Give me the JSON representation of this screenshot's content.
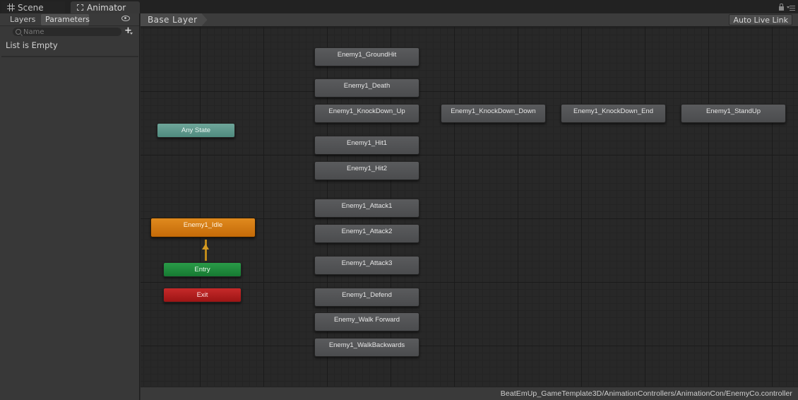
{
  "tabs": {
    "scene": {
      "label": "Scene",
      "icon": "grid-icon"
    },
    "animator": {
      "label": "Animator",
      "icon": "animator-icon"
    }
  },
  "left_panel": {
    "tabs": [
      "Layers",
      "Parameters"
    ],
    "active_tab": "Parameters",
    "search": {
      "placeholder": "Name",
      "value": ""
    },
    "empty_message": "List is Empty"
  },
  "graph": {
    "breadcrumb": "Base Layer",
    "auto_live_link": "Auto Live Link",
    "special_nodes": {
      "any_state": "Any State",
      "entry": "Entry",
      "exit": "Exit",
      "default_state": "Enemy1_Idle"
    },
    "states": [
      "Enemy1_GroundHit",
      "Enemy1_Death",
      "Enemy1_KnockDown_Up",
      "Enemy1_KnockDown_Down",
      "Enemy1_KnockDown_End",
      "Enemy1_StandUp",
      "Enemy1_Hit1",
      "Enemy1_Hit2",
      "Enemy1_Attack1",
      "Enemy1_Attack2",
      "Enemy1_Attack3",
      "Enemy1_Defend",
      "Enemy_Walk Forward",
      "Enemy1_WalkBackwards"
    ],
    "colors": {
      "any_state": "#5f9a8e",
      "default_state": "#d17a12",
      "entry": "#1f8a3c",
      "exit": "#b01e1e",
      "state": "#525355"
    }
  },
  "status_bar": {
    "path": "BeatEmUp_GameTemplate3D/AnimationControllers/AnimationCon/EnemyCo.controller"
  }
}
